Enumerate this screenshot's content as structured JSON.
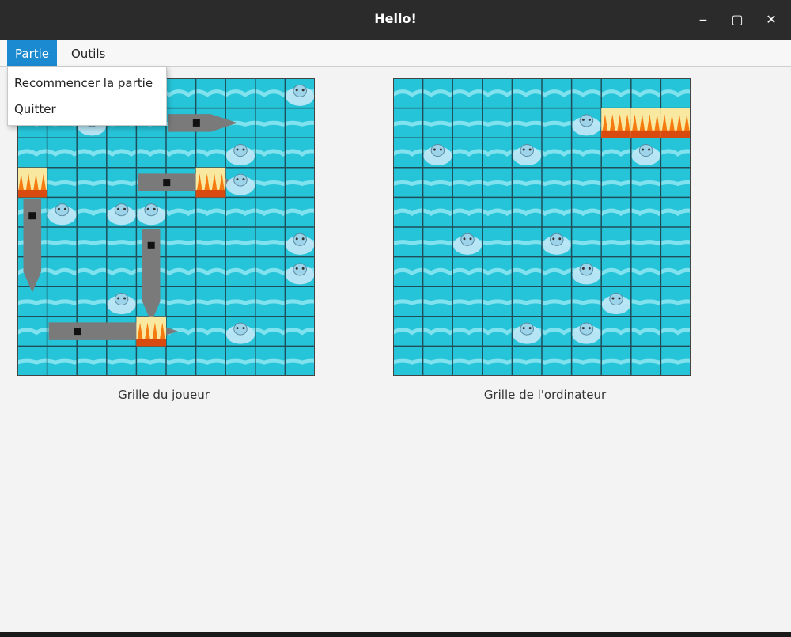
{
  "window": {
    "title": "Hello!",
    "controls": {
      "minimize": "‒",
      "maximize": "▢",
      "close": "✕"
    }
  },
  "menubar": {
    "items": [
      {
        "label": "Partie",
        "active": true
      },
      {
        "label": "Outils",
        "active": false
      }
    ]
  },
  "partie_menu": {
    "items": [
      {
        "label": "Recommencer la partie"
      },
      {
        "label": "Quitter"
      }
    ]
  },
  "grid_size": 10,
  "colors": {
    "water": "#26c4d8",
    "water_light": "#8fe8f2",
    "grid_line": "#1f4e5a",
    "ship": "#7a7a7a",
    "fire": "#f57b10",
    "miss": "#bde7f5",
    "hud_accent": "#1b8ad0"
  },
  "player_grid": {
    "caption": "Grille du joueur",
    "ships": [
      {
        "row": 1,
        "col": 5,
        "length": 2,
        "orientation": "horizontal"
      },
      {
        "row": 3,
        "col": 4,
        "length": 3,
        "orientation": "horizontal"
      },
      {
        "row": 4,
        "col": 0,
        "length": 3,
        "orientation": "vertical"
      },
      {
        "row": 5,
        "col": 4,
        "length": 3,
        "orientation": "vertical"
      },
      {
        "row": 8,
        "col": 1,
        "length": 4,
        "orientation": "horizontal"
      }
    ],
    "hits": [
      [
        3,
        6
      ],
      [
        3,
        0
      ],
      [
        8,
        4
      ]
    ],
    "misses": [
      [
        0,
        9
      ],
      [
        1,
        2
      ],
      [
        2,
        7
      ],
      [
        3,
        7
      ],
      [
        4,
        1
      ],
      [
        4,
        3
      ],
      [
        4,
        4
      ],
      [
        5,
        9
      ],
      [
        6,
        9
      ],
      [
        7,
        3
      ],
      [
        8,
        7
      ]
    ]
  },
  "computer_grid": {
    "caption": "Grille de l'ordinateur",
    "ships": [
      {
        "row": 1,
        "col": 7,
        "length": 3,
        "orientation": "horizontal"
      }
    ],
    "hits": [
      [
        1,
        7
      ],
      [
        1,
        8
      ],
      [
        1,
        9
      ]
    ],
    "misses": [
      [
        1,
        6
      ],
      [
        2,
        1
      ],
      [
        2,
        4
      ],
      [
        2,
        8
      ],
      [
        5,
        2
      ],
      [
        5,
        5
      ],
      [
        6,
        6
      ],
      [
        7,
        7
      ],
      [
        8,
        4
      ],
      [
        8,
        6
      ]
    ]
  }
}
